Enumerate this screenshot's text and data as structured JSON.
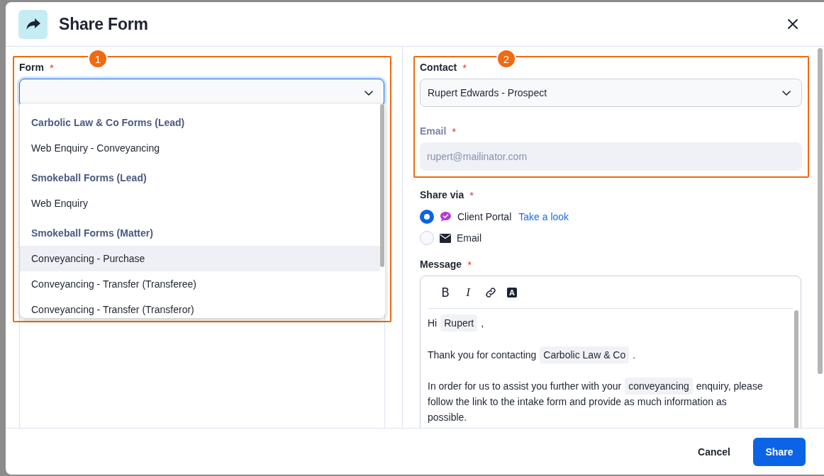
{
  "dialog": {
    "title": "Share Form"
  },
  "form_field": {
    "label": "Form",
    "required_mark": "*",
    "annotation": "1",
    "expanded": true,
    "groups": [
      {
        "heading": "Carbolic Law & Co Forms (Lead)",
        "items": [
          {
            "label": "Web Enquiry - Conveyancing",
            "highlighted": false
          }
        ]
      },
      {
        "heading": "Smokeball Forms (Lead)",
        "items": [
          {
            "label": "Web Enquiry",
            "highlighted": false
          }
        ]
      },
      {
        "heading": "Smokeball Forms (Matter)",
        "items": [
          {
            "label": "Conveyancing - Purchase",
            "highlighted": true
          },
          {
            "label": "Conveyancing - Transfer (Transferee)",
            "highlighted": false
          },
          {
            "label": "Conveyancing - Transfer (Transferor)",
            "highlighted": false
          }
        ]
      }
    ]
  },
  "contact_group": {
    "annotation": "2",
    "contact": {
      "label": "Contact",
      "required_mark": "*",
      "value": "Rupert Edwards - Prospect"
    },
    "email": {
      "label": "Email",
      "required_mark": "*",
      "value": "rupert@mailinator.com",
      "disabled": true
    }
  },
  "share_via": {
    "label": "Share via",
    "required_mark": "*",
    "options": [
      {
        "kind": "portal",
        "label": "Client Portal",
        "link": "Take a look",
        "selected": true
      },
      {
        "kind": "email",
        "label": "Email",
        "selected": false
      }
    ]
  },
  "message": {
    "label": "Message",
    "required_mark": "*",
    "toolbar": [
      {
        "kind": "bold",
        "glyph": "B"
      },
      {
        "kind": "italic",
        "glyph": "I"
      },
      {
        "kind": "link"
      },
      {
        "kind": "highlight",
        "glyph": "A"
      }
    ],
    "paragraphs": [
      [
        [
          {
            "kind": "text",
            "text": "Hi"
          },
          {
            "kind": "field",
            "text": "Rupert"
          },
          {
            "kind": "text",
            "text": ","
          }
        ]
      ],
      [
        [
          {
            "kind": "text",
            "text": "Thank you for contacting"
          },
          {
            "kind": "field",
            "text": "Carbolic Law & Co"
          },
          {
            "kind": "text",
            "text": "."
          }
        ]
      ],
      [
        [
          {
            "kind": "text",
            "text": "In order for us to assist you further with your"
          },
          {
            "kind": "field",
            "text": "conveyancing"
          },
          {
            "kind": "text",
            "text": "enquiry, please"
          }
        ],
        [
          {
            "kind": "text",
            "text": "follow the link to the intake form and provide as much information as"
          }
        ],
        [
          {
            "kind": "text",
            "text": "possible."
          }
        ]
      ]
    ]
  },
  "footer": {
    "buttons": [
      {
        "kind": "secondary",
        "label": "Cancel"
      },
      {
        "kind": "primary",
        "label": "Share"
      }
    ]
  }
}
